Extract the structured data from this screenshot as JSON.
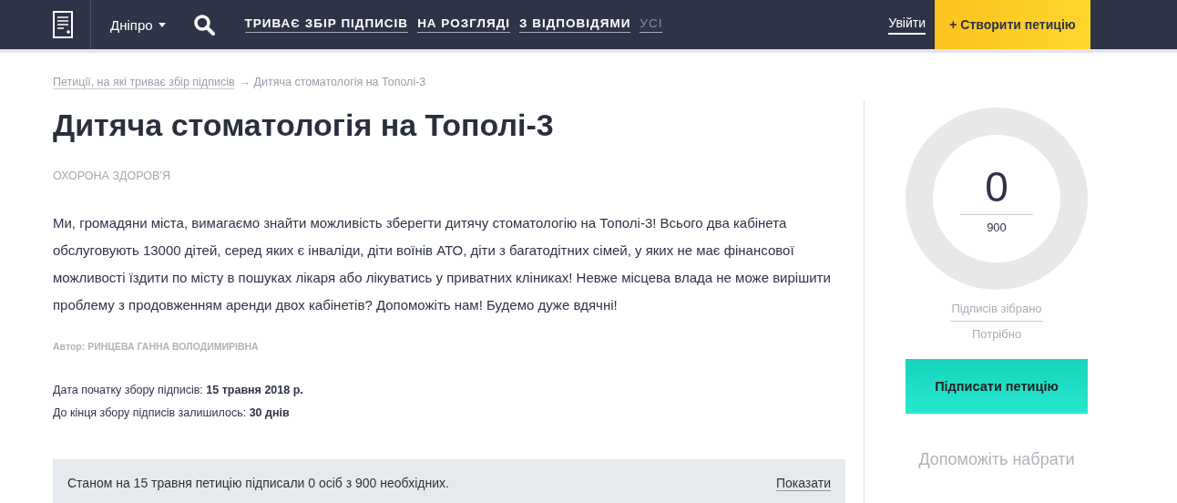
{
  "header": {
    "city": "Дніпро",
    "tabs": [
      {
        "label": "ТРИВАЄ ЗБІР ПІДПИСІВ",
        "muted": false
      },
      {
        "label": "НА РОЗГЛЯДІ",
        "muted": false
      },
      {
        "label": "З ВІДПОВІДЯМИ",
        "muted": false
      },
      {
        "label": "УСІ",
        "muted": true
      }
    ],
    "login": "Увійти",
    "create_button": "+ Створити петицію"
  },
  "breadcrumb": {
    "link": "Петиції, на які триває збір підписів",
    "current": "→ Дитяча стоматологія на Тополі-3"
  },
  "petition": {
    "title": "Дитяча стоматологія на Тополі-3",
    "category": "ОХОРОНА ЗДОРОВ’Я",
    "body": "Ми, громадяни міста, вимагаємо знайти можливість зберегти дитячу стоматологію на Тополі-3! Всього два кабінета обслуговують 13000 дітей, серед яких є інваліди, діти воїнів АТО, діти з багатодітних сімей, у яких не має фінансової можливості їздити по місту в пошуках лікаря або лікуватись у приватних кліниках! Невже місцева влада не може вирішити проблему з продовженням аренди двох кабінетів? Допоможіть нам! Будемо дуже вдячні!",
    "author": "Автор: РИНЦЕВА ГАННА ВОЛОДИМИРІВНА",
    "start_date": "Дата початку збору підписів: **15 травня 2018 р.**",
    "remaining": "До кінця збору підписів залишилось: **30 днів**",
    "status": "Станом на 15 травня петицію підписали 0 осіб з 900 необхідних.",
    "show_link": "Показати"
  },
  "sidebar": {
    "progress": {
      "collected": "0",
      "needed": "900"
    },
    "collected_label": "Підписів зібрано",
    "needed_label": "Потрібно",
    "sign_button": "Підписати петицію",
    "help_text": "Допоможіть набрати"
  }
}
